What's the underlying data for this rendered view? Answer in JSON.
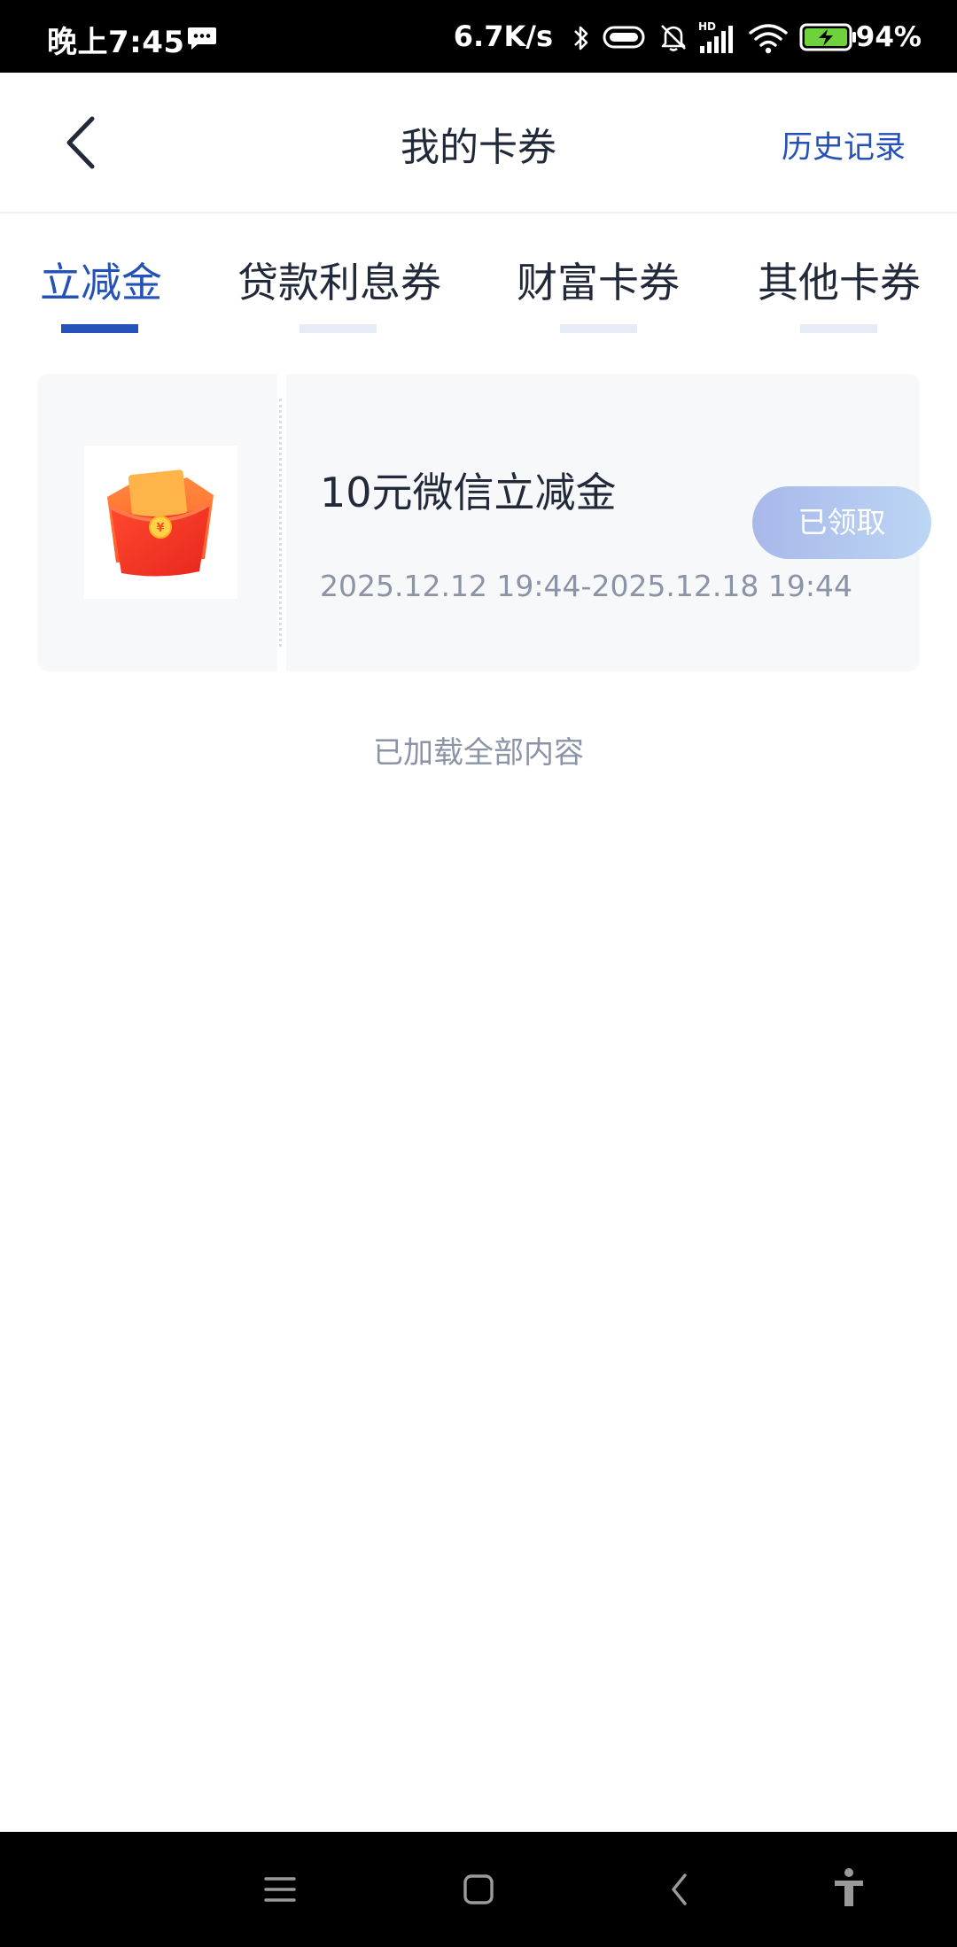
{
  "status_bar": {
    "time": "晚上7:45",
    "net_speed": "6.7K/s",
    "battery": "94%",
    "icons": [
      "message-icon",
      "bluetooth-icon",
      "mobile-data-icon",
      "mute-bell-icon",
      "hd-signal-icon",
      "wifi-icon",
      "battery-charging-icon"
    ]
  },
  "header": {
    "title": "我的卡券",
    "history_label": "历史记录",
    "back_icon": "chevron-left-icon"
  },
  "tabs": [
    {
      "label": "立减金",
      "active": true
    },
    {
      "label": "贷款利息券",
      "active": false
    },
    {
      "label": "财富卡券",
      "active": false
    },
    {
      "label": "其他卡券",
      "active": false
    }
  ],
  "coupons": [
    {
      "title": "10元微信立减金",
      "validity": "2025.12.12 19:44-2025.12.18 19:44",
      "status_label": "已领取",
      "image": "red-envelope-icon"
    }
  ],
  "list_footer": "已加载全部内容",
  "nav_bar": {
    "icons": [
      "menu-icon",
      "home-icon",
      "back-icon",
      "accessibility-icon"
    ]
  },
  "colors": {
    "accent": "#2452b8",
    "text_primary": "#222a3a",
    "text_secondary": "#8b93a6",
    "card_bg": "#f7f8fa",
    "tab_inactive_indicator": "#e5ebf7"
  }
}
